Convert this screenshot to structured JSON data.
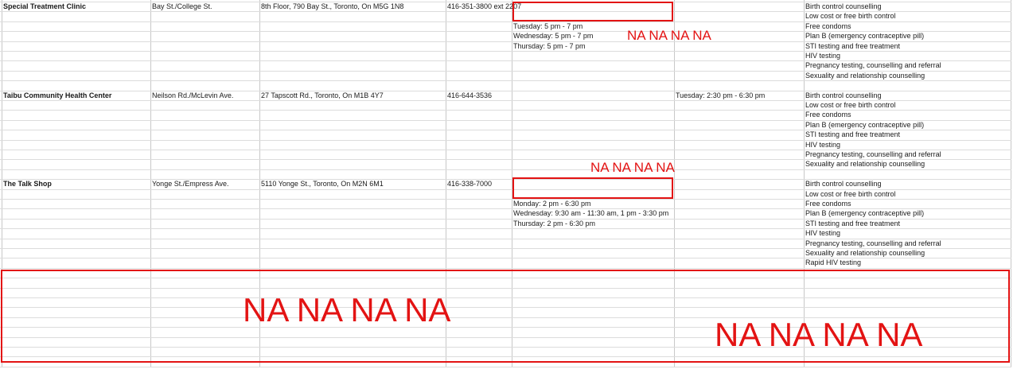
{
  "clinics": [
    {
      "name": "Special Treatment Clinic",
      "intersection": "Bay St./College St.",
      "address": "8th Floor, 790 Bay St., Toronto, On M5G 1N8",
      "phone": "416-351-3800 ext 2207",
      "hours_a": [
        "",
        "",
        "Tuesday: 5 pm - 7 pm",
        "Wednesday: 5 pm - 7 pm",
        "Thursday: 5 pm - 7 pm"
      ],
      "hours_b": [],
      "services": [
        "Birth control counselling",
        "Low cost or free birth control",
        "Free condoms",
        "Plan B (emergency contraceptive pill)",
        "STI testing and free treatment",
        "HIV testing",
        "Pregnancy testing, counselling and referral",
        "Sexuality and relationship counselling"
      ]
    },
    {
      "name": "Taibu Community Health Center",
      "intersection": "Neilson Rd./McLevin Ave.",
      "address": "27 Tapscott Rd., Toronto, On M1B 4Y7",
      "phone": "416-644-3536",
      "hours_a": [],
      "hours_b": [
        "Tuesday: 2:30 pm - 6:30 pm"
      ],
      "services": [
        "Birth control counselling",
        "Low cost or free birth control",
        "Free condoms",
        "Plan B (emergency contraceptive pill)",
        "STI testing and free treatment",
        "HIV testing",
        "Pregnancy testing, counselling and referral",
        "Sexuality and relationship counselling"
      ]
    },
    {
      "name": "The Talk Shop",
      "intersection": "Yonge St./Empress Ave.",
      "address": "5110 Yonge St., Toronto, On M2N 6M1",
      "phone": "416-338-7000",
      "hours_a": [
        "",
        "",
        "Monday: 2 pm - 6:30 pm",
        "Wednesday: 9:30 am - 11:30 am, 1 pm - 3:30 pm",
        "Thursday: 2 pm - 6:30 pm"
      ],
      "hours_b": [],
      "services": [
        "Birth control counselling",
        "Low cost or free birth control",
        "Free condoms",
        "Plan B (emergency contraceptive pill)",
        "STI testing and free treatment",
        "HIV testing",
        "Pregnancy testing, counselling and referral",
        "Sexuality and relationship counselling",
        "Rapid HIV testing"
      ]
    }
  ],
  "annotations": {
    "text_1": "NA NA NA NA",
    "text_2": "NA NA NA NA",
    "text_3": "NA NA NA NA",
    "text_4": "NA NA NA NA",
    "color": "#e31313"
  }
}
